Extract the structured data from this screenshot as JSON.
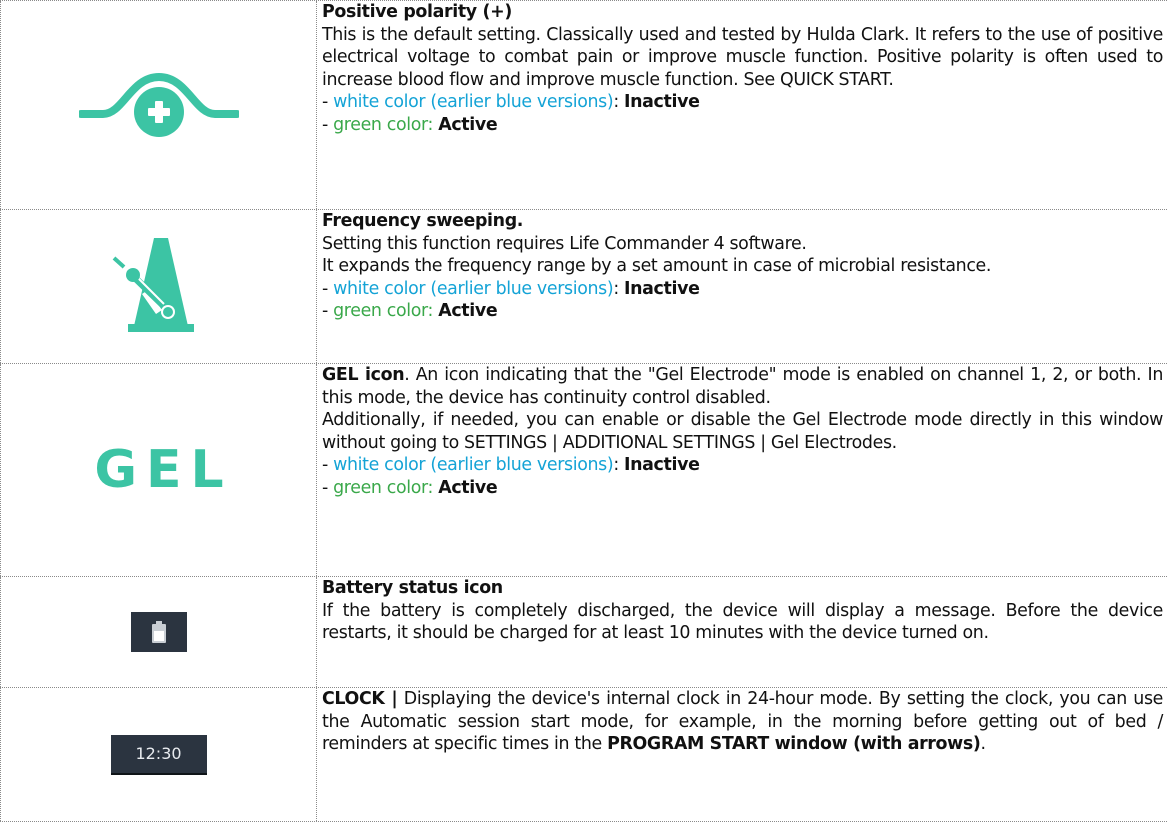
{
  "colors": {
    "icon_teal": "#3cc4a4",
    "link_blue": "#14a3d6",
    "active_green": "#3aa84a",
    "badge_dark": "#2b3440"
  },
  "rows": [
    {
      "icon": "positive-polarity-icon",
      "title": "Positive polarity (+)",
      "lines": [
        "This is the default setting. Classically used and tested by Hulda Clark. It refers to the use of positive electrical voltage to combat pain or improve muscle function. Positive polarity is often used to increase blood flow and improve muscle function. See QUICK START."
      ],
      "white_label": "white color (earlier blue versions)",
      "white_state": "Inactive",
      "green_label": "green color:",
      "green_state": "Active"
    },
    {
      "icon": "metronome-icon",
      "title": "Frequency sweeping.",
      "lines": [
        "Setting this function requires Life Commander 4 software.",
        "It expands the frequency range by a set amount in case of microbial resistance."
      ],
      "white_label": "white color (earlier blue versions)",
      "white_state": "Inactive",
      "green_label": "green color:",
      "green_state": "Active"
    },
    {
      "icon_text": "GEL",
      "title": "GEL icon",
      "intro": ". An icon indicating that the \"Gel Electrode\" mode is enabled on channel 1, 2, or both. In this mode, the device has continuity control disabled.",
      "lines": [
        "Additionally, if needed, you can enable or disable the Gel Electrode mode directly in this window without going to SETTINGS | ADDITIONAL SETTINGS | Gel Electrodes."
      ],
      "white_label": "white color (earlier blue versions)",
      "white_state": "Inactive",
      "green_label": "green color:",
      "green_state": "Active"
    },
    {
      "icon": "battery-icon",
      "title": "Battery status icon",
      "lines": [
        "If the battery is completely discharged, the device will display a message. Before the device restarts, it should be charged for at least 10 minutes with the device turned on."
      ]
    },
    {
      "icon_text": "12:30",
      "title": "CLOCK |",
      "intro": " Displaying the device's internal clock in 24-hour mode. By setting the clock, you can use the Automatic session start mode, for example, in the morning before getting out of bed / reminders at specific times in the ",
      "bold_tail": "PROGRAM START window (with arrows)",
      "tail_end": "."
    }
  ]
}
